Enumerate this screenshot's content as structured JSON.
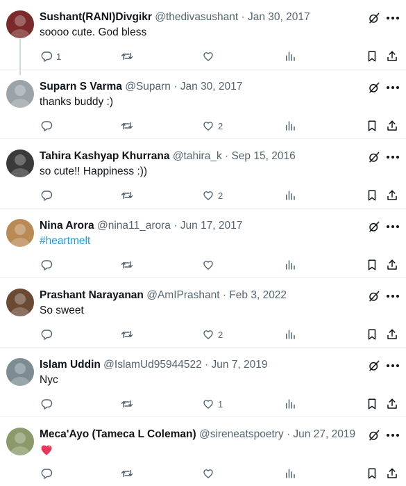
{
  "replies": [
    {
      "name": "Sushant(RANI)Divgikr",
      "meta": "@thedivasushant · Jan 30, 2017",
      "text": "soooo cute. God bless",
      "reply_count": "1",
      "repost_count": "",
      "like_count": "",
      "thread": true,
      "avatar_color": "#7a2a2a"
    },
    {
      "name": "Suparn S Varma",
      "meta": "@Suparn · Jan 30, 2017",
      "text": "thanks buddy :)",
      "reply_count": "",
      "repost_count": "",
      "like_count": "2",
      "avatar_color": "#9aa3a8"
    },
    {
      "name": "Tahira Kashyap Khurrana",
      "meta": "@tahira_k · Sep 15, 2016",
      "text": "so cute!! Happiness :))",
      "reply_count": "",
      "repost_count": "",
      "like_count": "2",
      "avatar_color": "#3a3a3a"
    },
    {
      "name": "Nina Arora",
      "meta": "@nina11_arora · Jun 17, 2017",
      "text": "#heartmelt",
      "text_is_link": true,
      "reply_count": "",
      "repost_count": "",
      "like_count": "",
      "avatar_color": "#b98a55"
    },
    {
      "name": "Prashant Narayanan",
      "meta": "@AmIPrashant · Feb 3, 2022",
      "text": "So sweet",
      "reply_count": "",
      "repost_count": "",
      "like_count": "2",
      "avatar_color": "#6b4a34"
    },
    {
      "name": "Islam Uddin",
      "meta": "@IslamUd95944522 · Jun 7, 2019",
      "text": "Nyc",
      "reply_count": "",
      "repost_count": "",
      "like_count": "1",
      "avatar_color": "#7d8c92"
    },
    {
      "name": "Meca'Ayo (Tameca L Coleman)",
      "meta": "@sireneatspoetry · Jun 27, 2019",
      "text": "",
      "emoji": "sparkling-heart",
      "reply_count": "",
      "repost_count": "",
      "like_count": "",
      "avatar_color": "#8a9a6a"
    }
  ],
  "icons": {
    "reply": "reply-icon",
    "repost": "repost-icon",
    "like": "like-icon",
    "views": "views-icon",
    "bookmark": "bookmark-icon",
    "share": "share-icon",
    "grok": "grok-icon",
    "more": "more-icon"
  },
  "colors": {
    "text": "#0f1419",
    "muted": "#536471",
    "link": "#1d9bf0",
    "divider": "#eff3f4",
    "heart_emoji": "#e8365d"
  }
}
